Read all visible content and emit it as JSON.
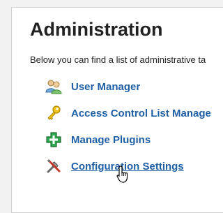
{
  "page": {
    "title": "Administration",
    "intro": "Below you can find a list of administrative ta"
  },
  "items": [
    {
      "label": "User Manager",
      "icon": "user-group-icon"
    },
    {
      "label": "Access Control List Manage",
      "icon": "key-icon"
    },
    {
      "label": "Manage Plugins",
      "icon": "plus-icon"
    },
    {
      "label": "Configuration Settings",
      "icon": "tools-icon",
      "state": "hover"
    }
  ],
  "colors": {
    "link": "#1f5fa5",
    "title": "#222222",
    "background": "#f2f2f2",
    "panel": "#ffffff"
  }
}
